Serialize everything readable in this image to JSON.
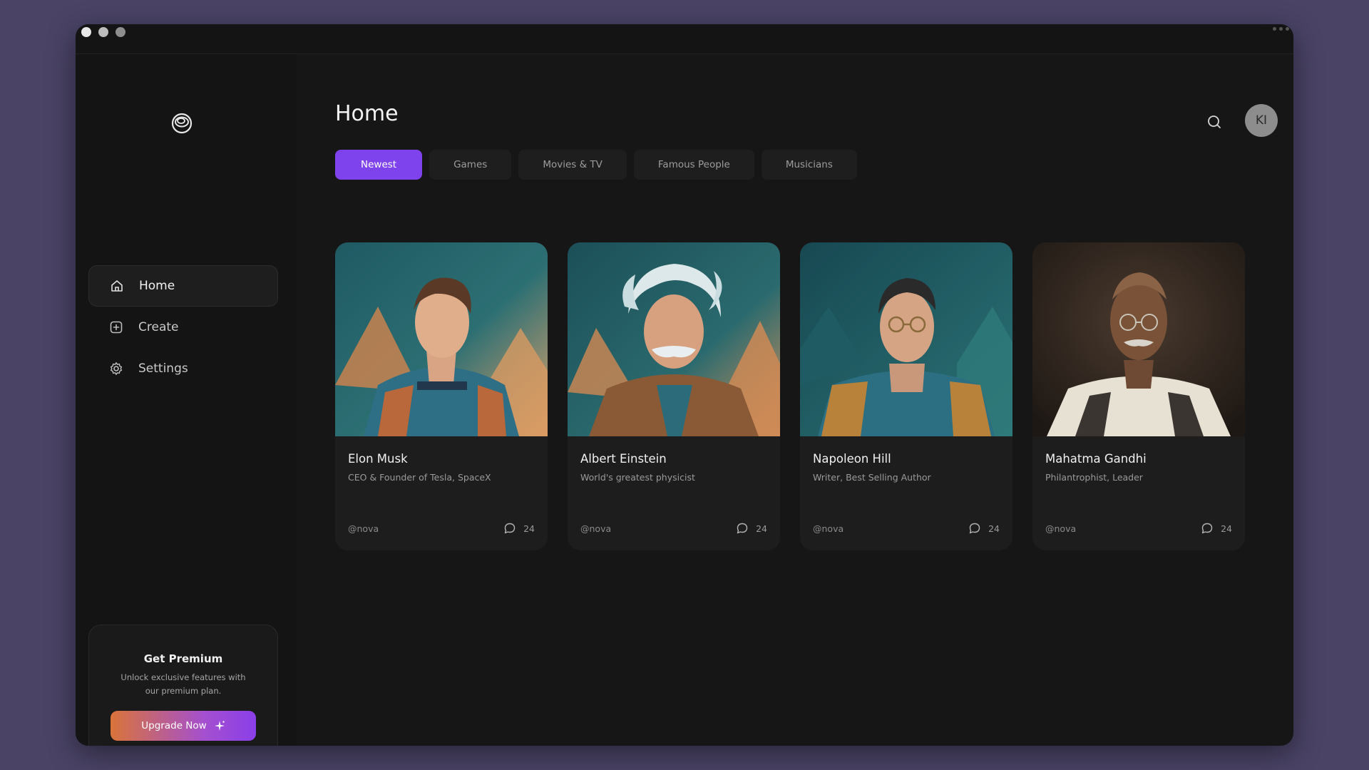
{
  "sidebar": {
    "nav": [
      {
        "label": "Home",
        "icon": "home-icon",
        "active": true
      },
      {
        "label": "Create",
        "icon": "plus-square-icon",
        "active": false
      },
      {
        "label": "Settings",
        "icon": "gear-icon",
        "active": false
      }
    ],
    "premium": {
      "title": "Get Premium",
      "description": "Unlock exclusive features with our premium plan.",
      "button_label": "Upgrade Now"
    }
  },
  "header": {
    "title": "Home",
    "avatar_initials": "KI"
  },
  "tabs": [
    {
      "label": "Newest",
      "active": true
    },
    {
      "label": "Games",
      "active": false
    },
    {
      "label": "Movies & TV",
      "active": false
    },
    {
      "label": "Famous People",
      "active": false
    },
    {
      "label": "Musicians",
      "active": false
    }
  ],
  "cards": [
    {
      "name": "Elon Musk",
      "description": "CEO & Founder of Tesla, SpaceX",
      "handle": "@nova",
      "count": "24"
    },
    {
      "name": "Albert Einstein",
      "description": "World's greatest physicist",
      "handle": "@nova",
      "count": "24"
    },
    {
      "name": "Napoleon Hill",
      "description": "Writer, Best Selling Author",
      "handle": "@nova",
      "count": "24"
    },
    {
      "name": "Mahatma Gandhi",
      "description": "Philantrophist, Leader",
      "handle": "@nova",
      "count": "24"
    }
  ],
  "colors": {
    "accent": "#7f43ee",
    "background": "#161616",
    "desktop": "#4a4366"
  }
}
